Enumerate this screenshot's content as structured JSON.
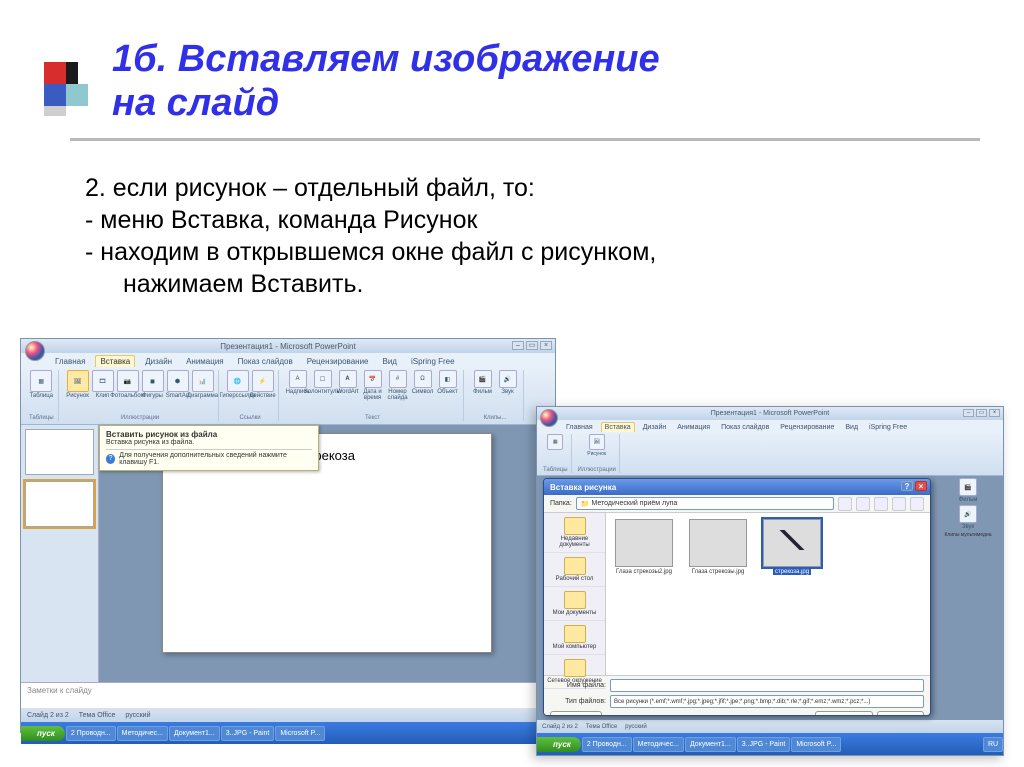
{
  "title_line1": "1б. Вставляем изображение",
  "title_line2": "на слайд",
  "body": {
    "l1": "2. если рисунок – отдельный файл, то:",
    "l2": "-  меню Вставка, команда Рисунок",
    "l3": "- находим в открывшемся окне файл с рисунком,",
    "l4": "нажимаем Вставить."
  },
  "shot1": {
    "window_title": "Презентация1 - Microsoft PowerPoint",
    "tabs": [
      "Главная",
      "Вставка",
      "Дизайн",
      "Анимация",
      "Показ слайдов",
      "Рецензирование",
      "Вид",
      "iSpring Free"
    ],
    "active_tab": "Вставка",
    "ribbon": {
      "g1": {
        "label": "Таблицы",
        "items": [
          "Таблица"
        ]
      },
      "g2": {
        "label": "Иллюстрации",
        "items": [
          "Рисунок",
          "Клип",
          "Фотоальбом",
          "Фигуры",
          "SmartArt",
          "Диаграмма"
        ]
      },
      "g3": {
        "label": "Ссылки",
        "items": [
          "Гиперссылка",
          "Действие"
        ]
      },
      "g4": {
        "label": "Текст",
        "items": [
          "Надпись",
          "Колонтитулы",
          "WordArt",
          "Дата и время",
          "Номер слайда",
          "Символ",
          "Объект"
        ]
      },
      "g5": {
        "label": "Клипы...",
        "items": [
          "Фильм",
          "Звук"
        ]
      }
    },
    "tooltip": {
      "title": "Вставить рисунок из файла",
      "sub": "Вставка рисунка из файла.",
      "hint": "Для получения дополнительных сведений нажмите клавишу F1."
    },
    "slide_title": "Стрекоза",
    "notes_placeholder": "Заметки к слайду",
    "status": {
      "slide": "Слайд 2 из 2",
      "theme": "Тема Office",
      "lang": "русский"
    },
    "taskbar": {
      "start": "пуск",
      "items": [
        "2 Проводн...",
        "Методичес...",
        "Документ1...",
        "3..JPG - Paint",
        "Microsoft P..."
      ]
    }
  },
  "shot2": {
    "window_title": "Презентация1 - Microsoft PowerPoint",
    "tabs": [
      "Главная",
      "Вставка",
      "Дизайн",
      "Анимация",
      "Показ слайдов",
      "Рецензирование",
      "Вид",
      "iSpring Free"
    ],
    "active_tab": "Вставка",
    "ribbon_left": {
      "g1": "Таблицы",
      "g2": "Рисунок",
      "g3": "Иллюстрации"
    },
    "ribbon_right": {
      "items": [
        "Фильм",
        "Звук"
      ],
      "label": "Клипы мультимедиа"
    },
    "dialog": {
      "title": "Вставка рисунка",
      "folder_label": "Папка:",
      "folder_value": "Методический приём лупа",
      "places": [
        "Недавние документы",
        "Рабочий стол",
        "Мои документы",
        "Мой компьютер",
        "Сетевое окружение"
      ],
      "files": [
        {
          "name": "Глаза стрекозы2.jpg"
        },
        {
          "name": "Глаза стрекозы.jpg"
        },
        {
          "name": "стрекоза.jpg",
          "selected": true
        }
      ],
      "filename_label": "Имя файла:",
      "filename_value": "",
      "filetype_label": "Тип файлов:",
      "filetype_value": "Все рисунки (*.emf;*.wmf;*.jpg;*.jpeg;*.jfif;*.jpe;*.png;*.bmp;*.dib;*.rle;*.gif;*.emz;*.wmz;*.pcz;*...)",
      "tools_btn": "Сервис",
      "insert_btn": "Вставить",
      "cancel_btn": "Отмена"
    },
    "status": {
      "slide": "Слайд 2 из 2",
      "theme": "Тема Office",
      "lang": "русский"
    },
    "taskbar": {
      "start": "пуск",
      "items": [
        "2 Проводн...",
        "Методичес...",
        "Документ1...",
        "3..JPG - Paint",
        "Microsoft P...",
        "RU"
      ]
    }
  }
}
